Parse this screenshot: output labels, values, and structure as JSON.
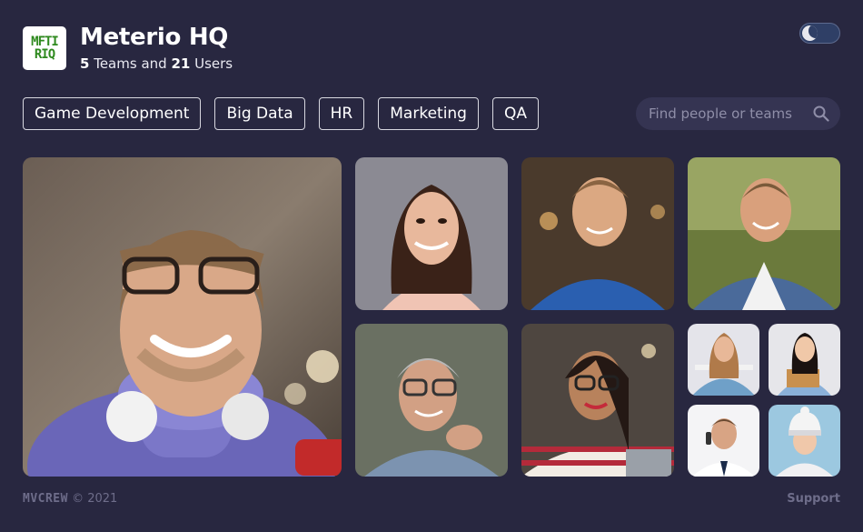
{
  "header": {
    "logo_line1": "MFTI",
    "logo_line2": "RIQ",
    "title": "Meterio HQ",
    "teams_count": "5",
    "teams_label": "Teams and",
    "users_count": "21",
    "users_label": "Users"
  },
  "theme_toggle": {
    "state": "dark"
  },
  "tags": [
    "Game Development",
    "Big Data",
    "HR",
    "Marketing",
    "QA"
  ],
  "search": {
    "placeholder": "Find people or teams",
    "value": ""
  },
  "footer": {
    "brand": "MVCREW",
    "copyright": "© 2021",
    "support": "Support"
  },
  "colors": {
    "background": "#282740",
    "tag_border": "#d8d8e0",
    "search_bg": "#353452",
    "muted_text": "#6e6d8a"
  }
}
